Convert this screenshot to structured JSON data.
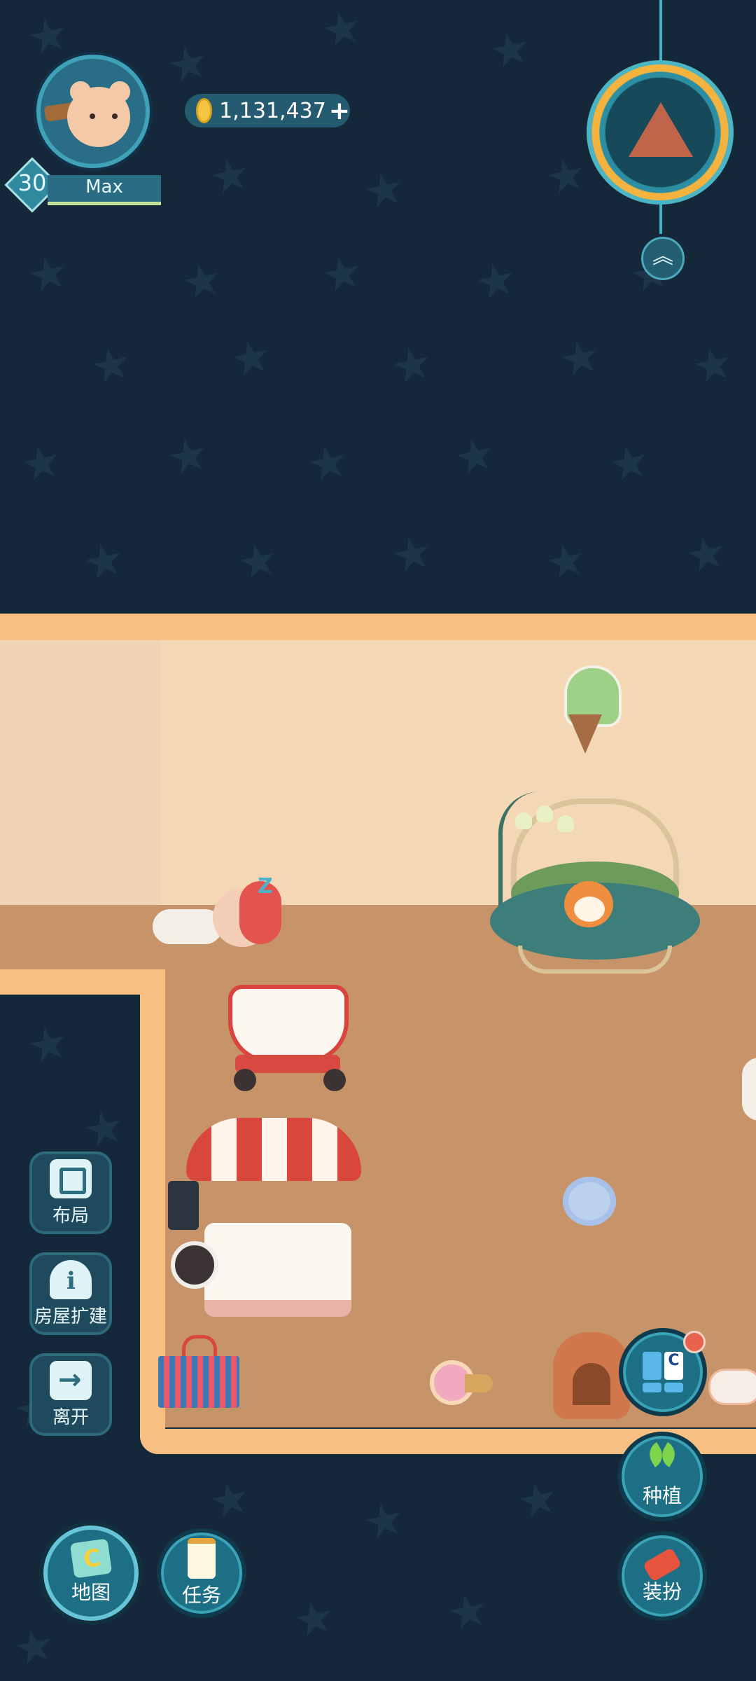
{
  "player": {
    "level": "30",
    "name": "Max",
    "coins": "1,131,437",
    "coin_plus": "+"
  },
  "top_right": {
    "medallion_icon": "pyramid-medallion-icon",
    "expand_glyph": "︽"
  },
  "side_menu": [
    {
      "label": "布局",
      "icon": "layout-icon"
    },
    {
      "label": "房屋扩建",
      "icon": "house-info-icon"
    },
    {
      "label": "离开",
      "icon": "exit-icon"
    }
  ],
  "bottom_left": [
    {
      "label": "地图",
      "icon": "map-icon"
    },
    {
      "label": "任务",
      "icon": "clipboard-icon"
    }
  ],
  "bottom_right": [
    {
      "label": "种植",
      "icon": "sprout-icon"
    },
    {
      "label": "装扮",
      "icon": "hammer-icon"
    }
  ],
  "build_menu": {
    "icon": "build-catalog-icon",
    "has_notification": true
  },
  "sleep_glyph": "Z",
  "colors": {
    "background": "#15283a",
    "wall": "#f4d8b6",
    "floor": "#c69468",
    "trim": "#f8bf82",
    "accent": "#1d6f86"
  }
}
